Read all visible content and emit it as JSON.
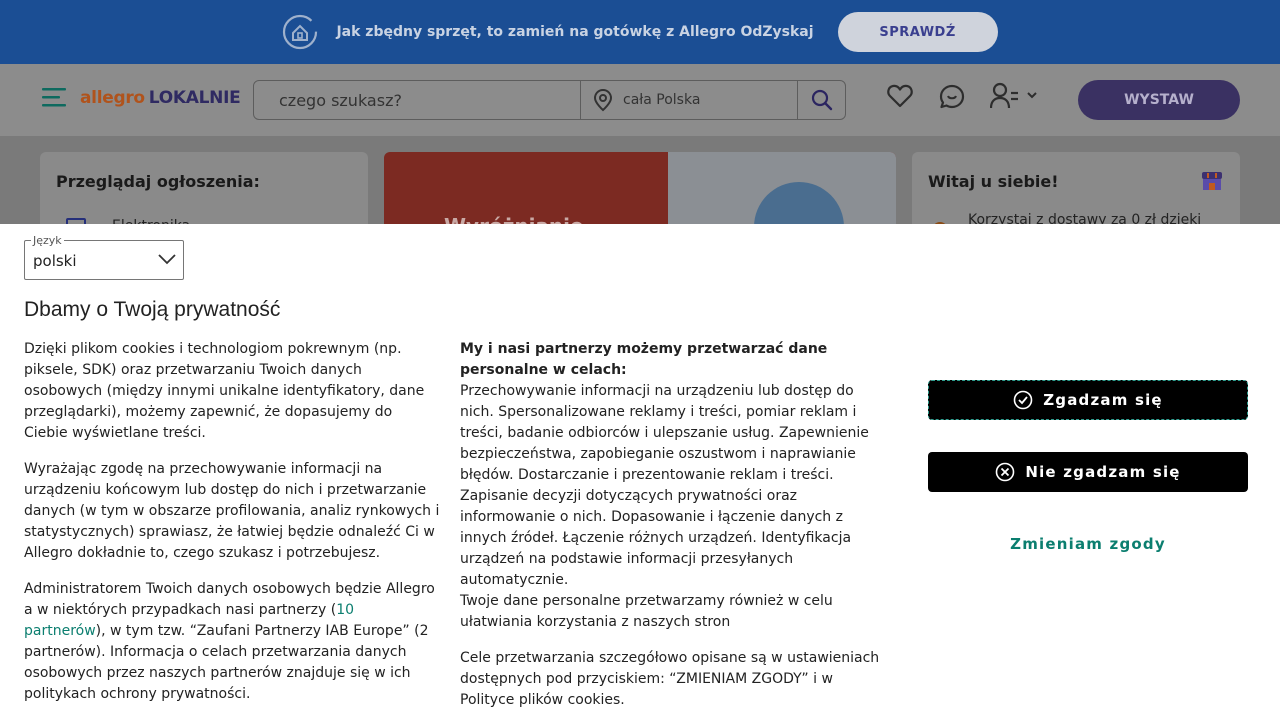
{
  "promo": {
    "text": "Jak zbędny sprzęt, to zamień na gotówkę z Allegro OdZyskaj",
    "button": "SPRAWDŹ"
  },
  "header": {
    "logo_part1": "allegro",
    "logo_part2": "LOKALNIE",
    "search_placeholder": "czego szukasz?",
    "location": "cała Polska",
    "post_button": "WYSTAW"
  },
  "background": {
    "browse_title": "Przeglądaj ogłoszenia:",
    "browse_first_item": "Elektronika",
    "banner_text": "Wyróżnianie",
    "welcome_title": "Witaj u siebie!",
    "welcome_text": "Korzystaj z dostawy za 0 zł dzięki"
  },
  "consent": {
    "language_label": "Język",
    "language_value": "polski",
    "title": "Dbamy o Twoją prywatność",
    "col1": {
      "p1": "Dzięki plikom cookies i technologiom pokrewnym (np. piksele, SDK) oraz przetwarzaniu Twoich danych osobowych (między innymi unikalne identyfikatory, dane przeglądarki), możemy zapewnić, że dopasujemy do Ciebie wyświetlane treści.",
      "p2": "Wyrażając zgodę na przechowywanie informacji na urządzeniu końcowym lub dostęp do nich i przetwarzanie danych (w tym w obszarze profilowania, analiz rynkowych i statystycznych) sprawiasz, że łatwiej będzie odnaleźć Ci w Allegro dokładnie to, czego szukasz i potrzebujesz.",
      "p3_before": "Administratorem Twoich danych osobowych będzie Allegro a w niektórych przypadkach nasi partnerzy (",
      "p3_link": "10 partnerów",
      "p3_after": "), w tym tzw. “Zaufani Partnerzy IAB Europe” (2 partnerów). Informacja o celach przetwarzania danych osobowych przez naszych partnerów znajduje się w ich politykach ochrony prywatności."
    },
    "col2": {
      "heading": "My i nasi partnerzy możemy przetwarzać dane personalne w celach:",
      "purposes": "Przechowywanie informacji na urządzeniu lub dostęp do nich. Spersonalizowane reklamy i treści, pomiar reklam i treści, badanie odbiorców i ulepszanie usług. Zapewnienie bezpieczeństwa, zapobieganie oszustwom i naprawianie błędów. Dostarczanie i prezentowanie reklam i treści. Zapisanie decyzji dotyczących prywatności oraz informowanie o nich. Dopasowanie i łączenie danych z innych źródeł. Łączenie różnych urządzeń. Identyfikacja urządzeń na podstawie informacji przesyłanych automatycznie.",
      "extra": "Twoje dane personalne przetwarzamy również w celu ułatwiania korzystania z naszych stron",
      "p2": "Cele przetwarzania szczegółowo opisane są w ustawieniach dostępnych pod przyciskiem: “ZMIENIAM ZGODY” i w Polityce plików cookies."
    },
    "accept_button": "Zgadzam się",
    "reject_button": "Nie zgadzam się",
    "manage_button": "Zmieniam zgody"
  },
  "colors": {
    "promo_bg": "#1b4e94",
    "accent_green": "#0b7e6f",
    "button_black": "#000000",
    "brand_orange": "#ff5a00",
    "brand_purple": "#5a4caa"
  }
}
